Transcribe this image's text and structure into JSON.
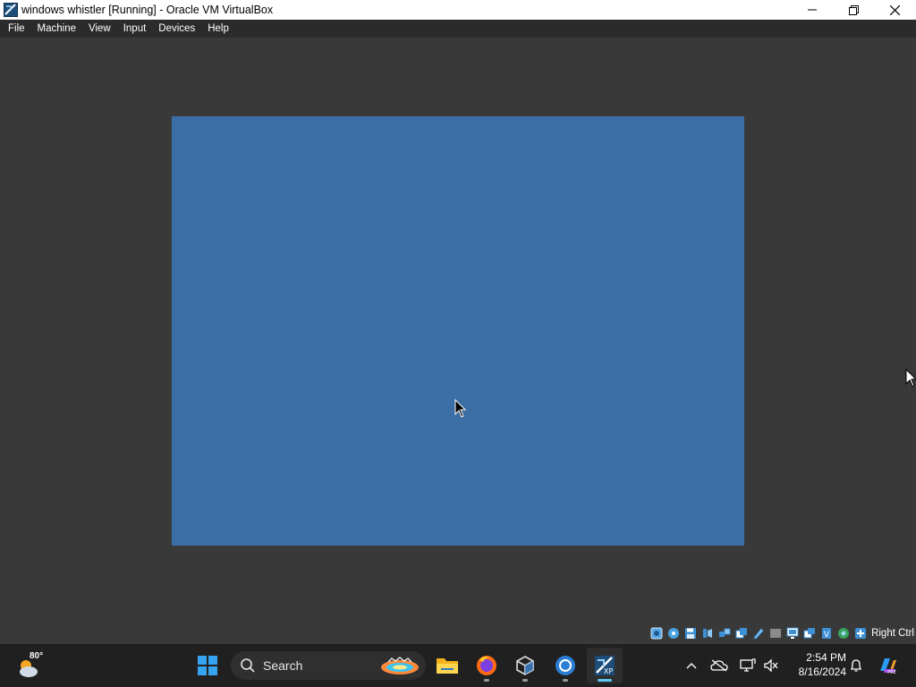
{
  "window": {
    "title": "windows whistler [Running] - Oracle VM VirtualBox",
    "controls": [
      "minimize-icon",
      "maximize-icon",
      "close-icon"
    ]
  },
  "menu": {
    "items": [
      {
        "label": "File"
      },
      {
        "label": "Machine"
      },
      {
        "label": "View"
      },
      {
        "label": "Input"
      },
      {
        "label": "Devices"
      },
      {
        "label": "Help"
      }
    ]
  },
  "vm": {
    "screen_color": "#3b6ea5"
  },
  "statusbar": {
    "icons": [
      "hard-disk-icon",
      "optical-drive-icon",
      "floppy-icon",
      "audio-icon",
      "network-icon",
      "usb-icon",
      "shared-folders-icon",
      "display-icon",
      "recording-icon",
      "cpu-icon",
      "mouse-integration-icon",
      "keyboard-icon"
    ],
    "host_key": "Right Ctrl"
  },
  "taskbar": {
    "weather": {
      "temp": "80°",
      "icon": "partly-cloudy-icon"
    },
    "search": {
      "label": "Search"
    },
    "apps": [
      "windows-start-icon",
      "file-explorer-icon",
      "firefox-icon",
      "virtualbox-icon",
      "chrome-icon",
      "virtualbox-vm-icon"
    ],
    "tray": {
      "time": "2:54 PM",
      "date": "8/16/2024"
    }
  }
}
